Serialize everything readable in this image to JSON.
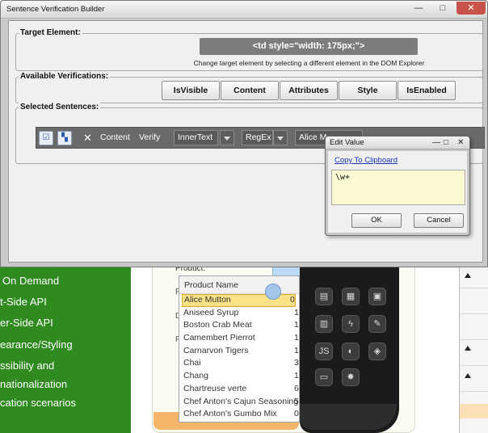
{
  "main_window": {
    "title": "Sentence Verification Builder",
    "controls": {
      "minimize": "—",
      "maximize": "□",
      "close": "✕"
    }
  },
  "target_element": {
    "label": "Target Element:",
    "value": "<td style=\"width: 175px;\">",
    "hint": "Change target element by selecting a different element in the DOM Explorer"
  },
  "available_verifications": {
    "label": "Available Verifications:",
    "buttons": [
      "IsVisible",
      "Content",
      "Attributes",
      "Style",
      "IsEnabled"
    ]
  },
  "selected_sentences": {
    "label": "Selected Sentences:",
    "close_glyph": "✕",
    "content_text": "Content",
    "verify_text": "Verify",
    "property_select": "InnerText",
    "compare_select": "RegEx",
    "value_select": "Alice M"
  },
  "edit_value": {
    "title": "Edit Value",
    "controls": {
      "minimize": "—",
      "maximize": "□",
      "close": "✕"
    },
    "copy_link": "Copy To Clipboard",
    "value": "\\w+",
    "ok": "OK",
    "cancel": "Cancel"
  },
  "background": {
    "nav_items": [
      "On Demand",
      "t-Side API",
      "er-Side API",
      "earance/Styling",
      "ssibility and",
      "nationalization",
      "cation scenarios"
    ],
    "product_label": "Product:",
    "side_letters": [
      "P",
      "D",
      "P"
    ],
    "list_header": "Product Name",
    "list_items": [
      {
        "name": "Alice Mutton",
        "num": "0"
      },
      {
        "name": "Aniseed Syrup",
        "num": "1"
      },
      {
        "name": "Boston Crab Meat",
        "num": "1"
      },
      {
        "name": "Camembert Pierrot",
        "num": "1"
      },
      {
        "name": "Carnarvon Tigers",
        "num": "1"
      },
      {
        "name": "Chai",
        "num": "3"
      },
      {
        "name": "Chang",
        "num": "1"
      },
      {
        "name": "Chartreuse verte",
        "num": "6"
      },
      {
        "name": "Chef Anton's Cajun Seasoning",
        "num": "5"
      },
      {
        "name": "Chef Anton's Gumbo Mix",
        "num": "0"
      }
    ],
    "selected_item_index": 0
  }
}
